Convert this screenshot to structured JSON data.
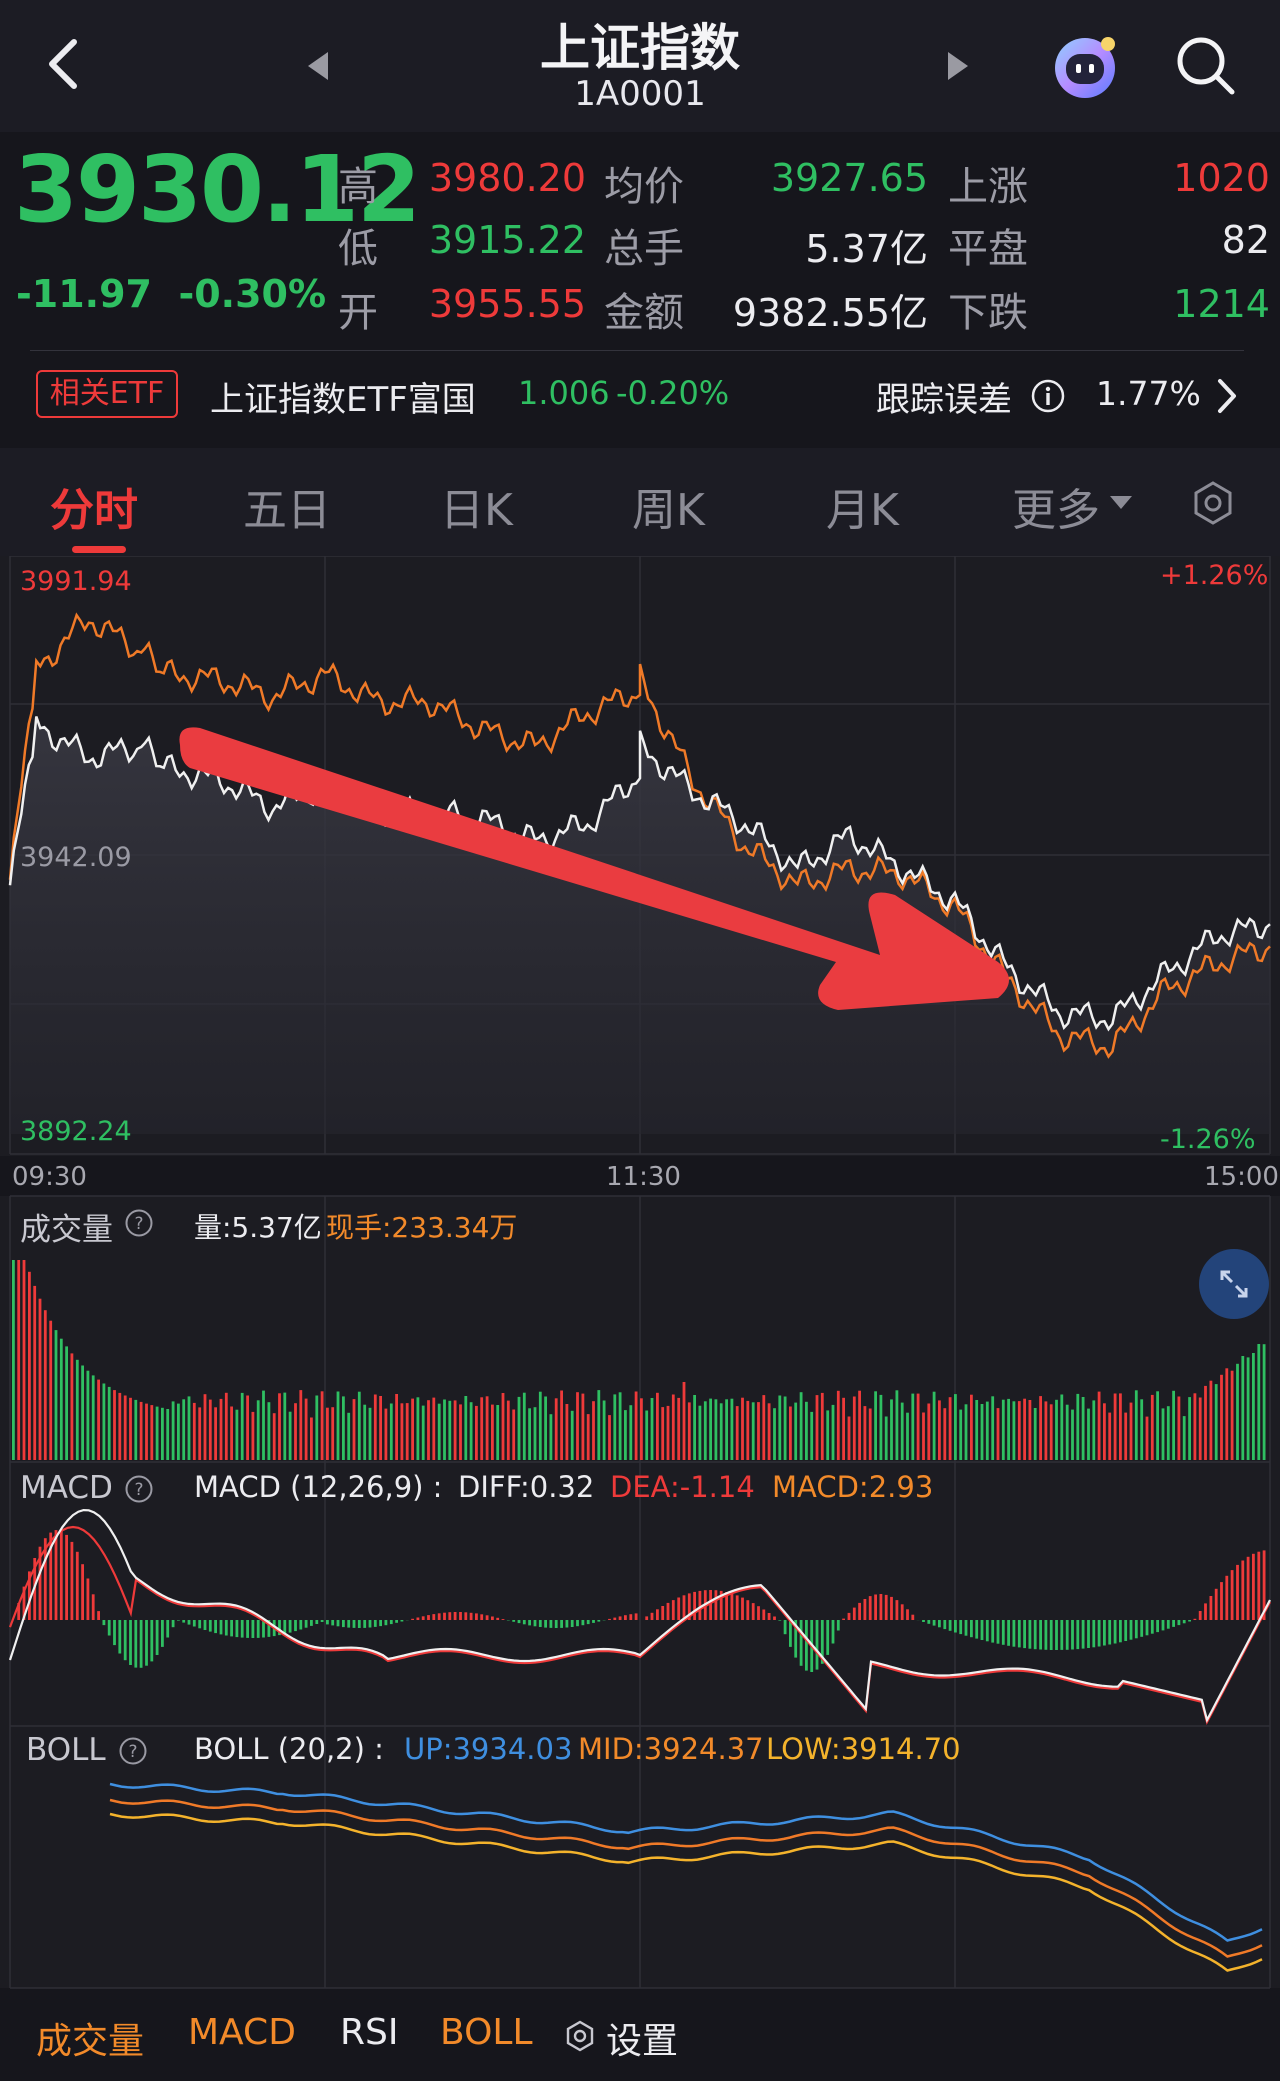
{
  "header": {
    "title": "上证指数",
    "code": "1A0001"
  },
  "quote": {
    "price": "3930.12",
    "change": "-11.97",
    "change_pct": "-0.30%",
    "high_label": "高",
    "high": "3980.20",
    "low_label": "低",
    "low": "3915.22",
    "open_label": "开",
    "open": "3955.55",
    "avg_label": "均价",
    "avg": "3927.65",
    "vol_label": "总手",
    "vol": "5.37亿",
    "amt_label": "金额",
    "amt": "9382.55亿",
    "up_label": "上涨",
    "up": "1020",
    "flat_label": "平盘",
    "flat": "82",
    "down_label": "下跌",
    "down": "1214"
  },
  "etf": {
    "tag": "相关ETF",
    "name": "上证指数ETF富国",
    "price": "1.006",
    "change_pct": "-0.20%",
    "tracking_label": "跟踪误差",
    "tracking_value": "1.77%"
  },
  "tabs": [
    "分时",
    "五日",
    "日K",
    "周K",
    "月K",
    "更多"
  ],
  "price_chart": {
    "top_price": "3991.94",
    "mid_price": "3942.09",
    "bottom_price": "3892.24",
    "top_pct": "+1.26%",
    "bottom_pct": "-1.26%",
    "times": [
      "09:30",
      "11:30",
      "15:00"
    ]
  },
  "volume": {
    "title": "成交量",
    "total": "量:5.37亿",
    "current": "现手:233.34万"
  },
  "macd": {
    "title": "MACD",
    "params": "MACD (12,26,9) :",
    "diff": "DIFF:0.32",
    "dea": "DEA:-1.14",
    "macd": "MACD:2.93"
  },
  "boll": {
    "title": "BOLL",
    "params": "BOLL (20,2) :",
    "up": "UP:3934.03",
    "mid": "MID:3924.37",
    "low": "LOW:3914.70"
  },
  "footer": {
    "items": [
      "成交量",
      "MACD",
      "RSI",
      "BOLL",
      "设置"
    ]
  },
  "colors": {
    "up": "#ee3a3a",
    "down": "#2fbf62",
    "price_line": "#f0f0f0",
    "avg_line": "#f07a28",
    "boll_up": "#3f8fe0",
    "boll_mid": "#f07a28",
    "boll_low": "#f4b32c"
  },
  "chart_data": {
    "type": "line",
    "title": "上证指数",
    "x_range": [
      "09:30",
      "15:00"
    ],
    "ylim": [
      3892.24,
      3991.94
    ],
    "prev_close": 3942.09,
    "series": [
      {
        "x": [
          "09:30",
          "09:35",
          "09:45",
          "09:55",
          "10:00",
          "10:10",
          "10:20",
          "10:30",
          "10:40",
          "10:50",
          "11:00",
          "11:10",
          "11:20",
          "11:30",
          "13:00",
          "13:10",
          "13:20",
          "13:30",
          "13:40",
          "13:50",
          "14:00",
          "14:10",
          "14:20",
          "14:30",
          "14:40",
          "14:50",
          "15:00"
        ],
        "values": [
          3937,
          3966,
          3960,
          3962,
          3958,
          3956,
          3951,
          3955,
          3950,
          3950,
          3949,
          3945,
          3948,
          3957,
          3962,
          3954,
          3948,
          3940,
          3946,
          3940,
          3934,
          3922,
          3914,
          3913,
          3921,
          3928,
          3930
        ]
      },
      {
        "x": [
          "09:30",
          "09:35",
          "09:45",
          "09:55",
          "10:00",
          "10:10",
          "10:20",
          "10:30",
          "10:40",
          "10:50",
          "11:00",
          "11:10",
          "11:20",
          "11:30",
          "13:00",
          "13:10",
          "13:20",
          "13:30",
          "13:40",
          "13:50",
          "14:00",
          "14:10",
          "14:20",
          "14:30",
          "14:40",
          "14:50",
          "15:00"
        ],
        "values": [
          3938,
          3976,
          3985,
          3979,
          3975,
          3974,
          3971,
          3975,
          3970,
          3970,
          3965,
          3962,
          3968,
          3972,
          3974,
          3956,
          3944,
          3937,
          3940,
          3939,
          3933,
          3920,
          3910,
          3908,
          3918,
          3923,
          3926
        ]
      }
    ]
  }
}
